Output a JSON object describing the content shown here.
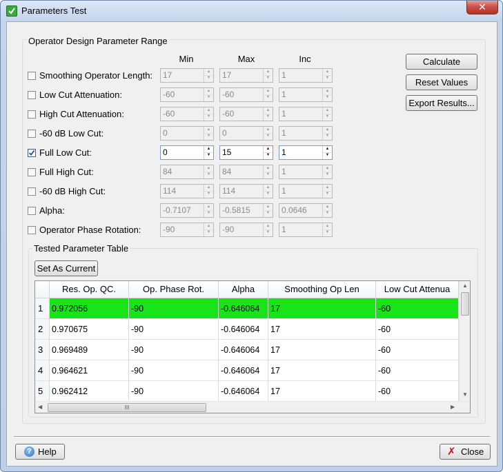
{
  "window": {
    "title": "Parameters Test",
    "close_glyph": "✕"
  },
  "range_group": {
    "title": "Operator Design Parameter Range",
    "col_min": "Min",
    "col_max": "Max",
    "col_inc": "Inc",
    "rows": [
      {
        "label": "Smoothing Operator Length:",
        "checked": false,
        "min": "17",
        "max": "17",
        "inc": "1"
      },
      {
        "label": "Low Cut Attenuation:",
        "checked": false,
        "min": "-60",
        "max": "-60",
        "inc": "1"
      },
      {
        "label": "High Cut Attenuation:",
        "checked": false,
        "min": "-60",
        "max": "-60",
        "inc": "1"
      },
      {
        "label": "-60 dB Low Cut:",
        "checked": false,
        "min": "0",
        "max": "0",
        "inc": "1"
      },
      {
        "label": "Full Low Cut:",
        "checked": true,
        "min": "0",
        "max": "15",
        "inc": "1"
      },
      {
        "label": "Full High Cut:",
        "checked": false,
        "min": "84",
        "max": "84",
        "inc": "1"
      },
      {
        "label": "-60 dB High Cut:",
        "checked": false,
        "min": "114",
        "max": "114",
        "inc": "1"
      },
      {
        "label": "Alpha:",
        "checked": false,
        "min": "-0.7107",
        "max": "-0.5815",
        "inc": "0.0646"
      },
      {
        "label": "Operator Phase Rotation:",
        "checked": false,
        "min": "-90",
        "max": "-90",
        "inc": "1"
      }
    ]
  },
  "buttons": {
    "calculate": "Calculate",
    "reset": "Reset Values",
    "export": "Export Results...",
    "set_current": "Set As Current",
    "help": "Help",
    "close": "Close"
  },
  "table": {
    "title": "Tested Parameter Table",
    "columns": [
      "Res. Op. QC.",
      "Op. Phase Rot.",
      "Alpha",
      "Smoothing Op Len",
      "Low Cut Attenua"
    ],
    "rows": [
      {
        "num": "1",
        "cells": [
          "0.972056",
          "-90",
          "-0.646064",
          "17",
          "-60"
        ],
        "selected": true
      },
      {
        "num": "2",
        "cells": [
          "0.970675",
          "-90",
          "-0.646064",
          "17",
          "-60"
        ],
        "selected": false
      },
      {
        "num": "3",
        "cells": [
          "0.969489",
          "-90",
          "-0.646064",
          "17",
          "-60"
        ],
        "selected": false
      },
      {
        "num": "4",
        "cells": [
          "0.964621",
          "-90",
          "-0.646064",
          "17",
          "-60"
        ],
        "selected": false
      },
      {
        "num": "5",
        "cells": [
          "0.962412",
          "-90",
          "-0.646064",
          "17",
          "-60"
        ],
        "selected": false
      }
    ],
    "selected_color": "#19e319",
    "scroll_grip": "III"
  },
  "icons": {
    "app": "check-icon",
    "help": "question-circle-icon",
    "close": "red-x-icon"
  }
}
